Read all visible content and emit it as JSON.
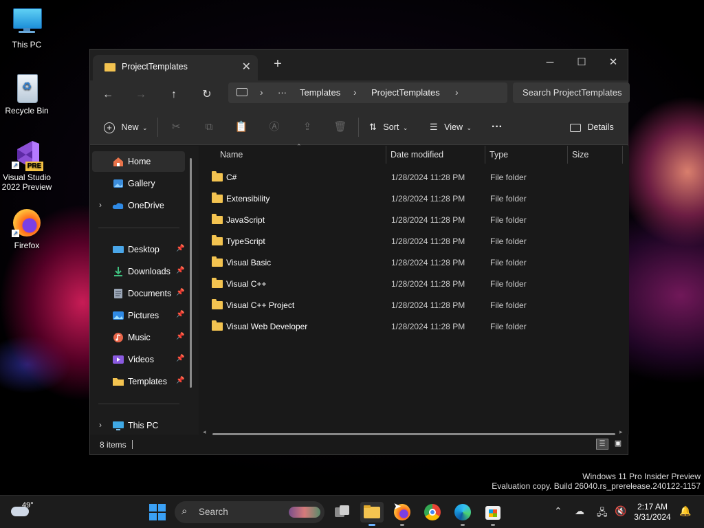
{
  "desktop": {
    "icons": [
      {
        "label": "This PC"
      },
      {
        "label": "Recycle Bin"
      },
      {
        "label": "Visual Studio 2022 Preview",
        "badge": "PRE"
      },
      {
        "label": "Firefox"
      }
    ],
    "watermark_line1": "Windows 11 Pro Insider Preview",
    "watermark_line2": "Evaluation copy. Build 26040.rs_prerelease.240122-1157"
  },
  "explorer": {
    "tab_title": "ProjectTemplates",
    "breadcrumb": [
      "Templates",
      "ProjectTemplates"
    ],
    "search_placeholder": "Search ProjectTemplates",
    "toolbar": {
      "new": "New",
      "sort": "Sort",
      "view": "View",
      "details": "Details"
    },
    "nav": {
      "top": [
        {
          "label": "Home",
          "icon": "home-icon"
        },
        {
          "label": "Gallery",
          "icon": "gallery-icon"
        },
        {
          "label": "OneDrive",
          "icon": "cloud-icon"
        }
      ],
      "pinned": [
        {
          "label": "Desktop",
          "icon": "desktop-icon"
        },
        {
          "label": "Downloads",
          "icon": "download-icon"
        },
        {
          "label": "Documents",
          "icon": "document-icon"
        },
        {
          "label": "Pictures",
          "icon": "picture-icon"
        },
        {
          "label": "Music",
          "icon": "music-icon"
        },
        {
          "label": "Videos",
          "icon": "video-icon"
        },
        {
          "label": "Templates",
          "icon": "folder-icon"
        }
      ],
      "bottom": [
        {
          "label": "This PC",
          "icon": "computer-icon"
        }
      ]
    },
    "columns": [
      "Name",
      "Date modified",
      "Type",
      "Size"
    ],
    "rows": [
      {
        "name": "C#",
        "date": "1/28/2024 11:28 PM",
        "type": "File folder"
      },
      {
        "name": "Extensibility",
        "date": "1/28/2024 11:28 PM",
        "type": "File folder"
      },
      {
        "name": "JavaScript",
        "date": "1/28/2024 11:28 PM",
        "type": "File folder"
      },
      {
        "name": "TypeScript",
        "date": "1/28/2024 11:28 PM",
        "type": "File folder"
      },
      {
        "name": "Visual Basic",
        "date": "1/28/2024 11:28 PM",
        "type": "File folder"
      },
      {
        "name": "Visual C++",
        "date": "1/28/2024 11:28 PM",
        "type": "File folder"
      },
      {
        "name": "Visual C++ Project",
        "date": "1/28/2024 11:28 PM",
        "type": "File folder"
      },
      {
        "name": "Visual Web Developer",
        "date": "1/28/2024 11:28 PM",
        "type": "File folder"
      }
    ],
    "status_count": "8 items"
  },
  "taskbar": {
    "weather_temp": "49°",
    "search_label": "Search",
    "time": "2:17 AM",
    "date": "3/31/2024"
  }
}
